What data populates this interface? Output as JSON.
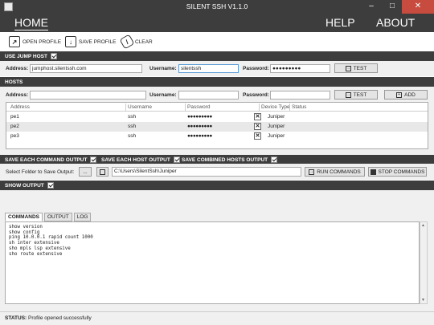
{
  "window": {
    "title": "SILENT SSH V1.1.0",
    "min": "–",
    "max": "□",
    "close": "✕"
  },
  "menu": {
    "home": "HOME",
    "help": "HELP",
    "about": "ABOUT"
  },
  "toolbar": {
    "open_label": "OPEN PROFILE",
    "save_label": "SAVE PROFILE",
    "clear_label": "CLEAR"
  },
  "jump_host": {
    "section_label": "USE JUMP HOST",
    "checked": true,
    "address_label": "Address:",
    "address": "jumphost.silentssh.com",
    "username_label": "Username:",
    "username": "silentssh",
    "password_label": "Password:",
    "password": "●●●●●●●●●",
    "test_label": "TEST"
  },
  "hosts": {
    "section_label": "HOSTS",
    "address_label": "Address:",
    "username_label": "Username:",
    "password_label": "Password:",
    "test_label": "TEST",
    "add_label": "ADD",
    "columns": [
      "Address",
      "Username",
      "Password",
      "Device Type",
      "Status"
    ],
    "rows": [
      {
        "address": "pe1",
        "username": "ssh",
        "password": "●●●●●●●●●",
        "device_type": "Juniper",
        "status": ""
      },
      {
        "address": "pe2",
        "username": "ssh",
        "password": "●●●●●●●●●",
        "device_type": "Juniper",
        "status": ""
      },
      {
        "address": "pe3",
        "username": "ssh",
        "password": "●●●●●●●●●",
        "device_type": "Juniper",
        "status": ""
      }
    ]
  },
  "save_options": {
    "each_command": "SAVE EACH COMMAND OUTPUT",
    "each_host": "SAVE EACH HOST OUTPUT",
    "combined": "SAVE COMBINED HOSTS OUTPUT",
    "folder_label": "Select Folder to Save Output:",
    "browse_label": "...",
    "folder_path": "C:\\Users\\SilentSsh\\Juniper",
    "run_label": "RUN COMMANDS",
    "stop_label": "STOP COMMANDS"
  },
  "output": {
    "section_label": "SHOW OUTPUT",
    "tabs": [
      "COMMANDS",
      "OUTPUT",
      "LOG"
    ],
    "commands": "show version\nshow config\nping 10.0.0.1 rapid count 1000\nsh inter extensive\nsho mpls lsp extensive\nsho route extensive"
  },
  "status": {
    "label": "STATUS:",
    "text": "Profile opened successfully"
  }
}
